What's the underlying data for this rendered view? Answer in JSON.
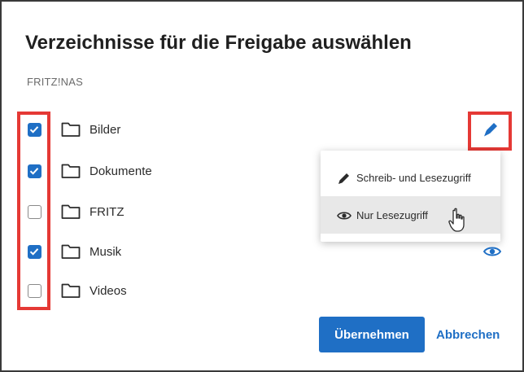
{
  "dialog": {
    "title": "Verzeichnisse für die Freigabe auswählen",
    "subtitle": "FRITZ!NAS"
  },
  "folders": [
    {
      "name": "Bilder",
      "checked": true,
      "access_icon": "pencil-icon"
    },
    {
      "name": "Dokumente",
      "checked": true
    },
    {
      "name": "FRITZ",
      "checked": false
    },
    {
      "name": "Musik",
      "checked": true,
      "access_icon": "eye-icon"
    },
    {
      "name": "Videos",
      "checked": false
    }
  ],
  "access_menu": {
    "items": [
      {
        "label": "Schreib- und Lesezugriff",
        "icon": "pencil-icon"
      },
      {
        "label": "Nur Lesezugriff",
        "icon": "eye-icon",
        "hovered": true
      }
    ]
  },
  "buttons": {
    "apply_label": "Übernehmen",
    "cancel_label": "Abbrechen"
  },
  "colors": {
    "accent": "#1f6fc5",
    "highlight": "#e53935",
    "menu_hover": "#e8e8e8"
  }
}
